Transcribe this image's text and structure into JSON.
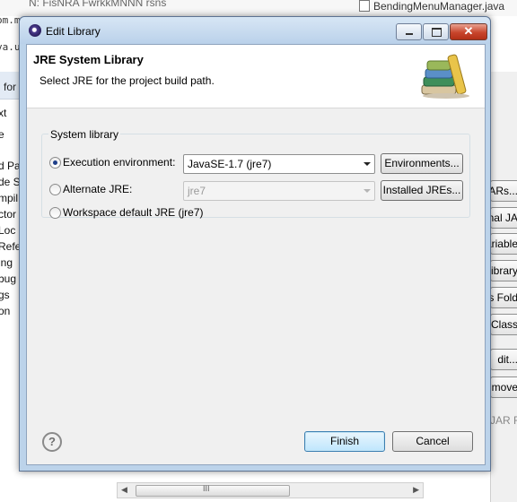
{
  "background": {
    "top_text": "N: FisNRA FwrkkMNNN rsns",
    "editor_tab": "BendingMenuManager.java",
    "editor_lines": [
      "om.m",
      "va.u"
    ],
    "left_for": "for",
    "left_items": [
      "xt",
      "e",
      "d Pa",
      "de St",
      "mpil",
      "ctor",
      "Loc",
      "Refe",
      "ing",
      "bug",
      "gs",
      "on"
    ],
    "right_buttons": [
      "JARs...",
      "rnal JA",
      "ariable",
      "ibrary",
      "ss Fold",
      "Class",
      "dit...",
      "move"
    ],
    "right_text": "JAR F",
    "scrollbar_grip": "III"
  },
  "dialog": {
    "title": "Edit Library",
    "window_buttons": {
      "minimize": "minimize",
      "maximize": "maximize",
      "close": "✕"
    },
    "header": {
      "title": "JRE System Library",
      "description": "Select JRE for the project build path."
    },
    "group_label": "System library",
    "options": [
      {
        "label": "Execution environment:",
        "selected": true
      },
      {
        "label": "Alternate JRE:",
        "selected": false
      },
      {
        "label": "Workspace default JRE (jre7)",
        "selected": false
      }
    ],
    "execution_env_value": "JavaSE-1.7 (jre7)",
    "alternate_jre_value": "jre7",
    "environments_button": "Environments...",
    "installed_jres_button": "Installed JREs...",
    "help_symbol": "?",
    "finish_button": "Finish",
    "cancel_button": "Cancel"
  }
}
